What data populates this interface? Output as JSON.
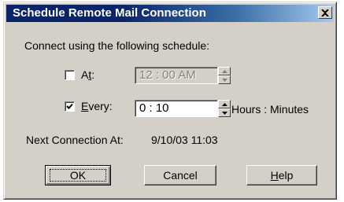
{
  "window": {
    "title": "Schedule Remote Mail Connection"
  },
  "intro": "Connect using the following schedule:",
  "at": {
    "label_prefix": "A",
    "label_hotkey": "t",
    "label_suffix": ":",
    "checked": false,
    "time_value": "12 : 00  AM"
  },
  "every": {
    "label_hotkey": "E",
    "label_rest": "very:",
    "checked": true,
    "value": "0 : 10",
    "unit": "Hours : Minutes"
  },
  "next": {
    "label": "Next Connection At:",
    "value": "9/10/03 11:03"
  },
  "buttons": {
    "ok": "OK",
    "cancel": "Cancel",
    "help_hotkey": "H",
    "help_rest": "elp"
  },
  "icons": [
    "close-icon",
    "checkmark-icon",
    "spin-up-icon",
    "spin-down-icon"
  ],
  "colors": {
    "face": "#d4d0c8",
    "title_start": "#0a246a",
    "title_end": "#a6caf0"
  }
}
